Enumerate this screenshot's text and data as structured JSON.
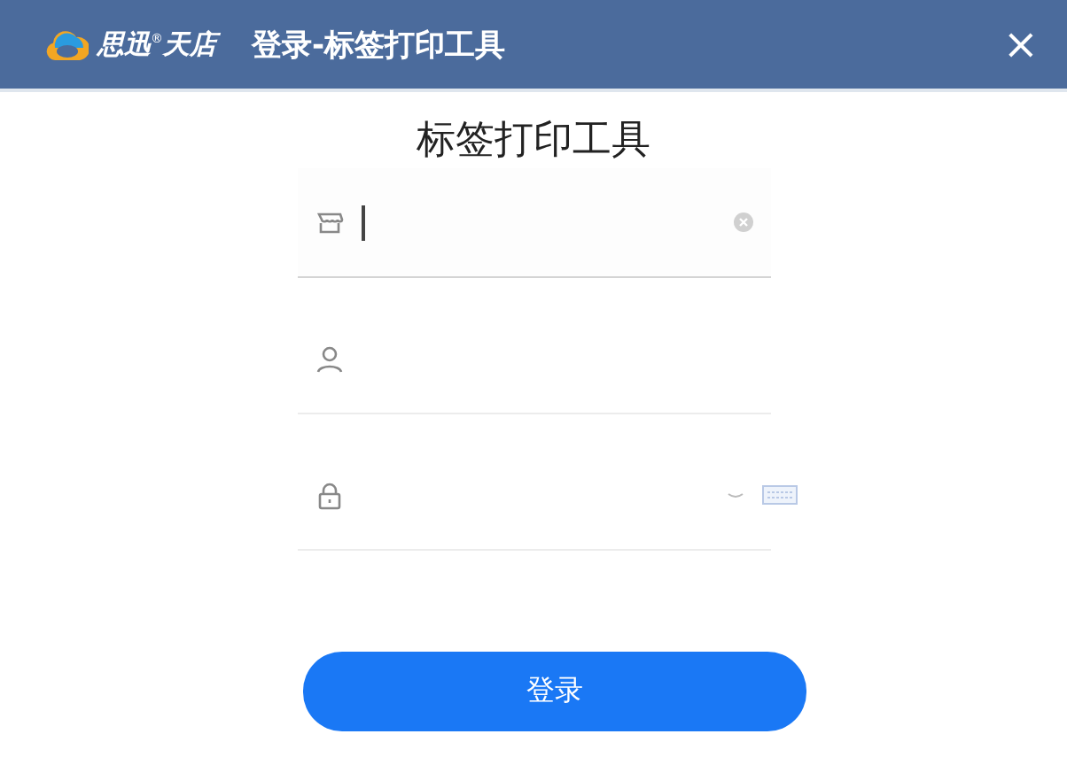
{
  "window": {
    "brand": "思迅$^{®}$天店",
    "title": "登录-标签打印工具",
    "close": "×"
  },
  "heading": "标签打印工具",
  "fields": [
    {
      "kind": "store",
      "focused": true
    },
    {
      "kind": "user",
      "focused": false
    },
    {
      "kind": "password",
      "focused": false
    }
  ],
  "login_button": "登录"
}
